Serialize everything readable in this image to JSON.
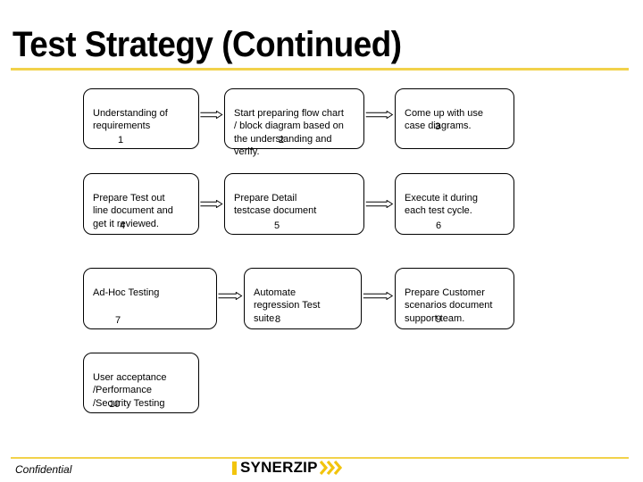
{
  "slide": {
    "title": "Test Strategy (Continued)",
    "accent_color": "#f2d24b"
  },
  "steps": [
    {
      "text": "Understanding of\nrequirements",
      "number": "1"
    },
    {
      "text": "Start preparing flow chart\n/ block diagram based on\nthe understanding and\nverify.",
      "number": "2"
    },
    {
      "text": "Come up with use\ncase diagrams.",
      "number": "3"
    },
    {
      "text": "Prepare Test out\nline document and\nget it reviewed.",
      "number": "4"
    },
    {
      "text": "Prepare Detail\ntestcase document",
      "number": "5"
    },
    {
      "text": "Execute it during\neach test cycle.",
      "number": "6"
    },
    {
      "text": "Ad-Hoc Testing",
      "number": "7"
    },
    {
      "text": "Automate\nregression Test\nsuite.",
      "number": "8"
    },
    {
      "text": "Prepare Customer\nscenarios document\nsupport team.",
      "number": "9"
    },
    {
      "text": "User acceptance\n/Performance\n/Security Testing",
      "number": "10"
    }
  ],
  "footer": {
    "confidential": "Confidential",
    "logo_text": "SYNERZIP",
    "logo_color": "#f2c40d"
  }
}
